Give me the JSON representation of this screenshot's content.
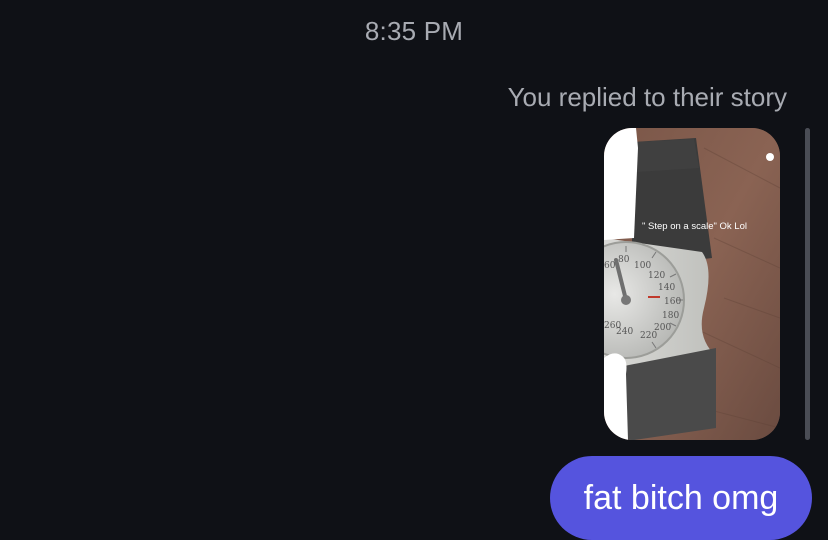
{
  "conversation": {
    "timestamp": "8:35 PM",
    "reply_note": "You replied to their story",
    "story": {
      "caption": "\" Step on a scale\" Ok Lol",
      "dial_numbers": [
        "60",
        "80",
        "100",
        "120",
        "140",
        "160",
        "180",
        "200",
        "220",
        "240",
        "260"
      ]
    },
    "message": {
      "text": "fat bitch omg",
      "bubble_color": "#5554de"
    }
  },
  "colors": {
    "background": "#0f1116",
    "muted_text": "#a8abb2",
    "bubble": "#5554de"
  }
}
